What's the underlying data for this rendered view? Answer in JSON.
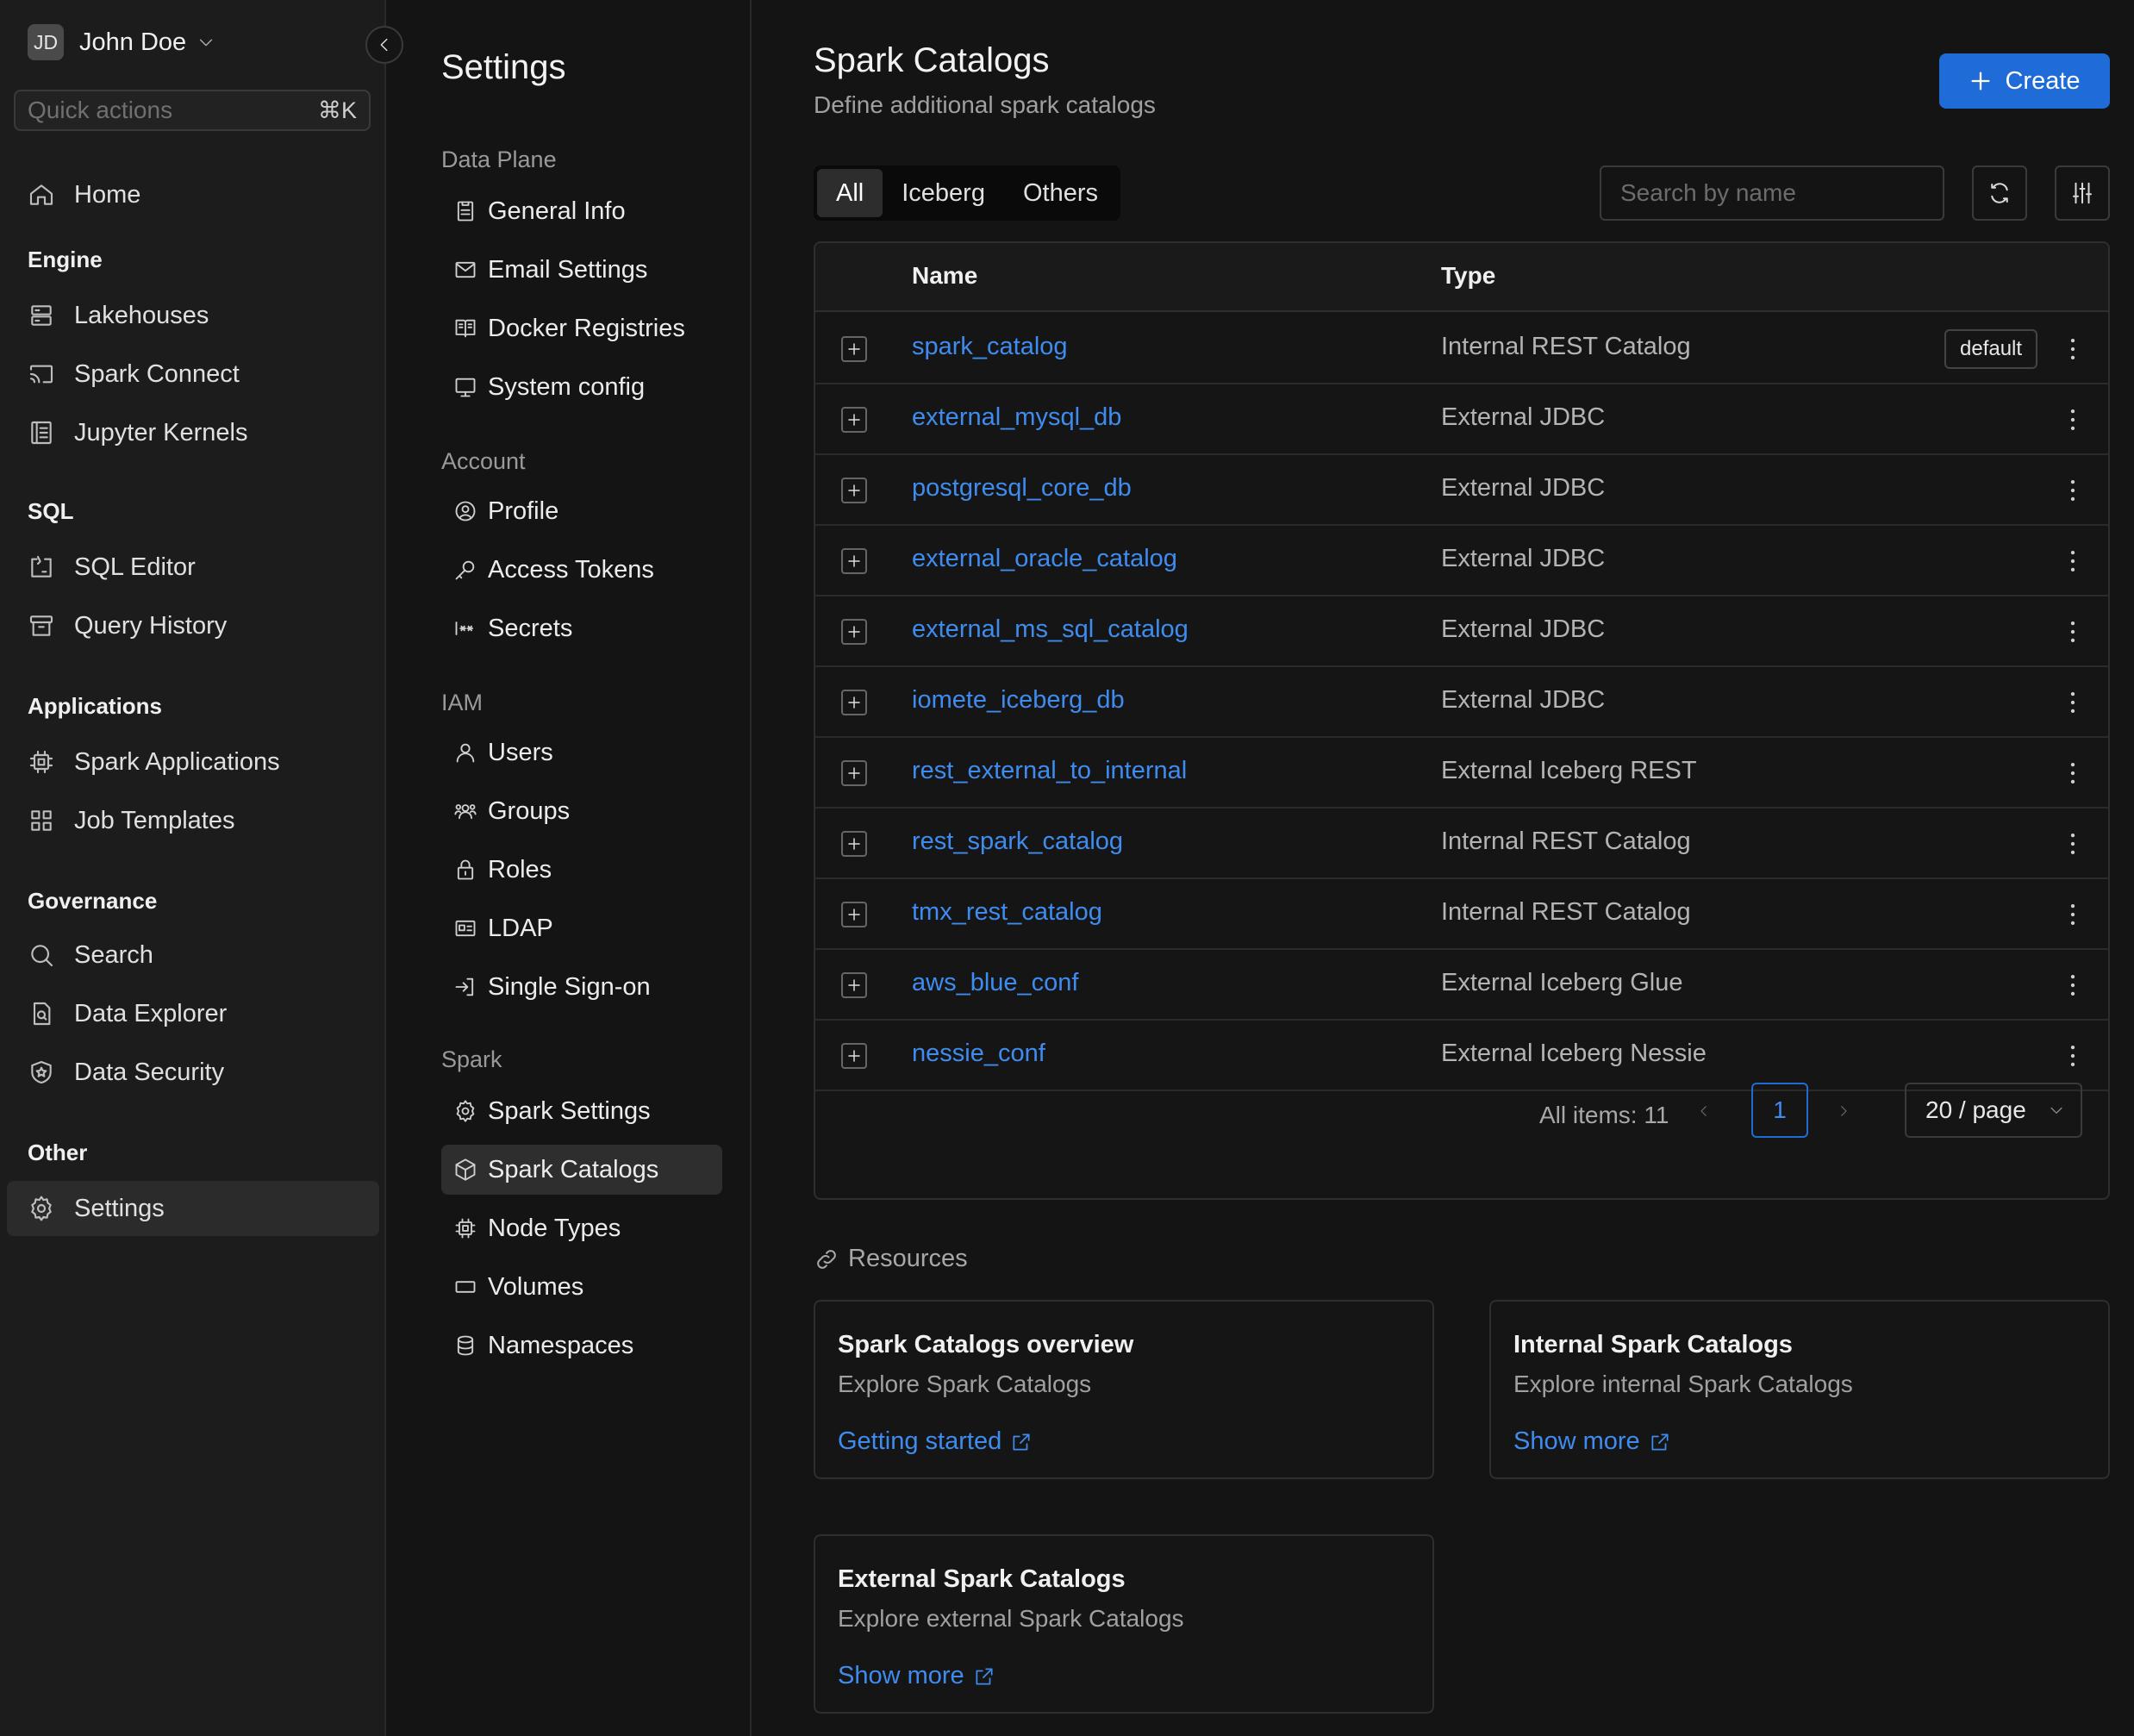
{
  "user": {
    "initials": "JD",
    "name": "John Doe"
  },
  "quick_actions": {
    "placeholder": "Quick actions",
    "shortcut": "⌘K"
  },
  "sidebar": {
    "home": "Home",
    "engine": {
      "title": "Engine",
      "items": [
        "Lakehouses",
        "Spark Connect",
        "Jupyter Kernels"
      ]
    },
    "sql": {
      "title": "SQL",
      "items": [
        "SQL Editor",
        "Query History"
      ]
    },
    "applications": {
      "title": "Applications",
      "items": [
        "Spark Applications",
        "Job Templates"
      ]
    },
    "governance": {
      "title": "Governance",
      "items": [
        "Search",
        "Data Explorer",
        "Data Security"
      ]
    },
    "other": {
      "title": "Other",
      "items": [
        "Settings"
      ]
    }
  },
  "settings": {
    "title": "Settings",
    "data_plane": {
      "title": "Data Plane",
      "items": [
        "General Info",
        "Email Settings",
        "Docker Registries",
        "System config"
      ]
    },
    "account": {
      "title": "Account",
      "items": [
        "Profile",
        "Access Tokens",
        "Secrets"
      ]
    },
    "iam": {
      "title": "IAM",
      "items": [
        "Users",
        "Groups",
        "Roles",
        "LDAP",
        "Single Sign-on"
      ]
    },
    "spark": {
      "title": "Spark",
      "items": [
        "Spark Settings",
        "Spark Catalogs",
        "Node Types",
        "Volumes",
        "Namespaces"
      ]
    }
  },
  "main": {
    "title": "Spark Catalogs",
    "subtitle": "Define additional spark catalogs",
    "create_label": "Create",
    "tabs": [
      "All",
      "Iceberg",
      "Others"
    ],
    "search_placeholder": "Search by name",
    "columns": [
      "Name",
      "Type"
    ],
    "rows": [
      {
        "name": "spark_catalog",
        "type": "Internal REST Catalog",
        "badge": "default"
      },
      {
        "name": "external_mysql_db",
        "type": "External JDBC"
      },
      {
        "name": "postgresql_core_db",
        "type": "External JDBC"
      },
      {
        "name": "external_oracle_catalog",
        "type": "External JDBC"
      },
      {
        "name": "external_ms_sql_catalog",
        "type": "External JDBC"
      },
      {
        "name": "iomete_iceberg_db",
        "type": "External JDBC"
      },
      {
        "name": "rest_external_to_internal",
        "type": "External Iceberg REST"
      },
      {
        "name": "rest_spark_catalog",
        "type": "Internal REST Catalog"
      },
      {
        "name": "tmx_rest_catalog",
        "type": "Internal REST Catalog"
      },
      {
        "name": "aws_blue_conf",
        "type": "External Iceberg Glue"
      },
      {
        "name": "nessie_conf",
        "type": "External Iceberg Nessie"
      }
    ],
    "pagination": {
      "all_items": "All items: 11",
      "page": "1",
      "page_size": "20 / page"
    },
    "resources": {
      "title": "Resources",
      "cards": [
        {
          "title": "Spark Catalogs overview",
          "subtitle": "Explore Spark Catalogs",
          "link": "Getting started"
        },
        {
          "title": "Internal Spark Catalogs",
          "subtitle": "Explore internal Spark Catalogs",
          "link": "Show more"
        },
        {
          "title": "External Spark Catalogs",
          "subtitle": "Explore external Spark Catalogs",
          "link": "Show more"
        }
      ]
    }
  },
  "colors": {
    "accent": "#1f6bd8",
    "link": "#3f8cf0",
    "background": "#141414",
    "sidebar": "#1c1c1c"
  }
}
